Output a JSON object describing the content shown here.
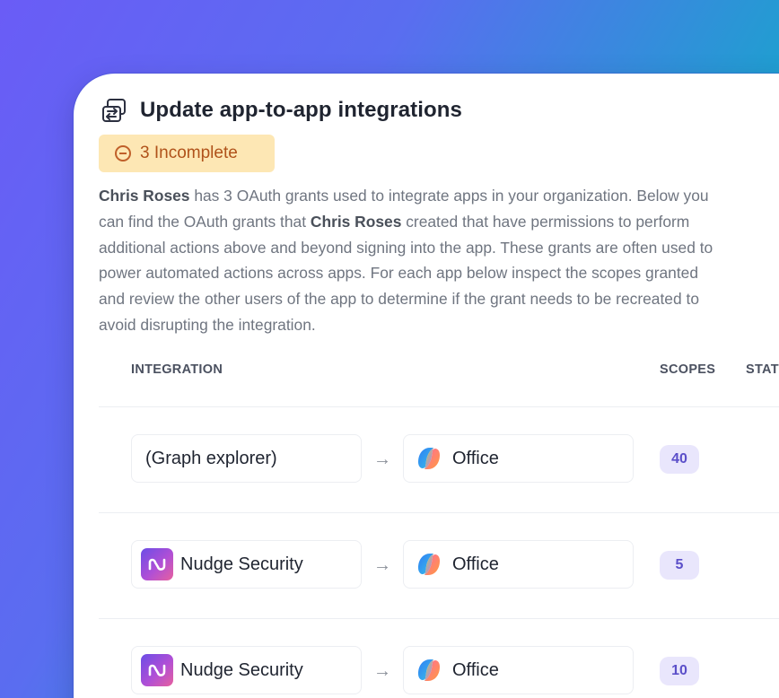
{
  "header": {
    "title": "Update app-to-app integrations",
    "status_badge": "3 Incomplete"
  },
  "description": {
    "line1_name": "Chris Roses",
    "line1_rest": " has 3 OAuth grants used to integrate apps in your organization. Below you",
    "line2_pre": "can find the OAuth grants that ",
    "line2_name": "Chris Roses",
    "line2_rest": " created that have permissions to perform",
    "line3": "additional actions above and beyond signing into the app. These grants are often used to",
    "line4": "power automated actions across apps. For each app below inspect the scopes granted",
    "line5": "and review the other users of the app to determine if the grant needs to be recreated to",
    "line6": "avoid disrupting the integration."
  },
  "table": {
    "columns": {
      "integration": "INTEGRATION",
      "scopes": "SCOPES",
      "status": "STATUS"
    },
    "rows": [
      {
        "source": "(Graph explorer)",
        "source_icon": "none",
        "destination": "Office",
        "destination_icon": "copilot-icon",
        "scopes": "40"
      },
      {
        "source": "Nudge Security",
        "source_icon": "nudge-security-icon",
        "destination": "Office",
        "destination_icon": "copilot-icon",
        "scopes": "5"
      },
      {
        "source": "Nudge Security",
        "source_icon": "nudge-security-icon",
        "destination": "Office",
        "destination_icon": "copilot-icon",
        "scopes": "10"
      }
    ],
    "arrow_glyph": "→"
  },
  "colors": {
    "badge_bg": "#fde7b4",
    "badge_text": "#b0521a",
    "scope_bg": "#e9e6fc",
    "scope_text": "#5b4fc9"
  }
}
